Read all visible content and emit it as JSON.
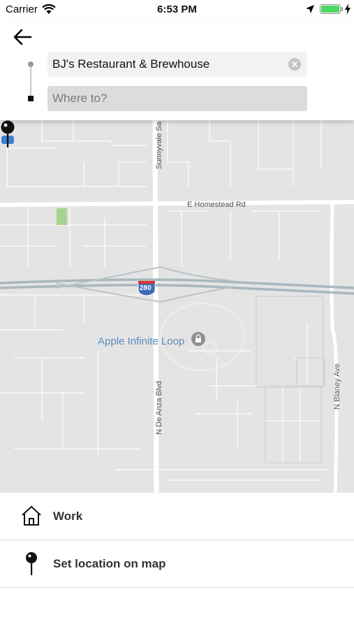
{
  "status_bar": {
    "carrier": "Carrier",
    "time": "6:53 PM",
    "battery_level": 1.0,
    "icons": [
      "wifi-icon",
      "location-arrow-icon",
      "battery-icon",
      "charging-bolt-icon"
    ]
  },
  "search": {
    "pickup_value": "BJ's Restaurant & Brewhouse",
    "destination_value": "",
    "destination_placeholder": "Where to?"
  },
  "map": {
    "roads": {
      "sunnyvale": "Sunnyvale Sa",
      "homestead": "E Homestead Rd",
      "interstate": "280",
      "de_anza": "N De Anza Blvd",
      "blaney": "N Blaney Ave"
    },
    "poi_label": "Apple Infinite Loop",
    "colors": {
      "background": "#e4e4e4",
      "road": "#ffffff",
      "highway": "#a9b7bd",
      "park": "#a6d38d",
      "poi": "#5b8dbd"
    }
  },
  "list": {
    "items": [
      {
        "label": "Work",
        "icon": "home-icon"
      },
      {
        "label": "Set location on map",
        "icon": "map-pin-icon"
      }
    ]
  }
}
